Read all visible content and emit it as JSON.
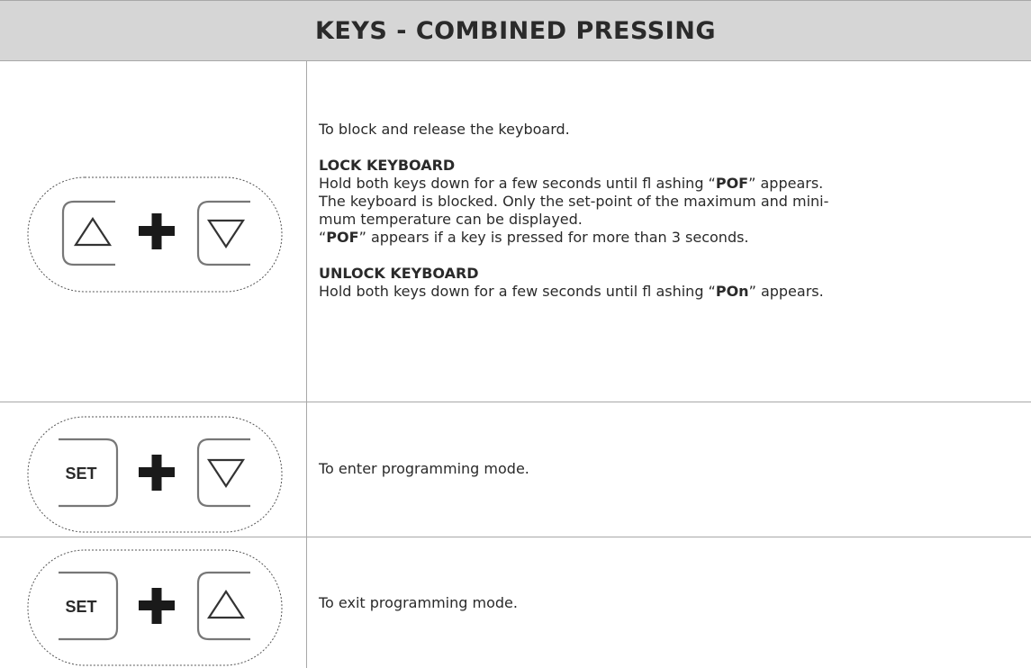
{
  "title": "KEYS - COMBINED PRESSING",
  "rows": [
    {
      "keys": {
        "left": "up-arrow",
        "right": "down-arrow"
      },
      "intro": "To block and release the keyboard.",
      "lock": {
        "heading": "LOCK KEYBOARD",
        "line1_a": "Hold both keys down for a few seconds until fl ashing “",
        "line1_code": "POF",
        "line1_b": "” appears.",
        "line2": "The keyboard is blocked. Only the set-point of the maximum and mini-",
        "line3": "mum temperature can be displayed.",
        "line4_a": "“",
        "line4_code": "POF",
        "line4_b": "” appears if a key is pressed for more than 3 seconds."
      },
      "unlock": {
        "heading": "UNLOCK KEYBOARD",
        "line1_a": "Hold both keys down for a few seconds until fl ashing “",
        "line1_code": "POn",
        "line1_b": "” appears."
      }
    },
    {
      "keys": {
        "left": "SET",
        "right": "down-arrow"
      },
      "text": "To enter programming mode."
    },
    {
      "keys": {
        "left": "SET",
        "right": "up-arrow"
      },
      "text": "To exit programming mode."
    }
  ]
}
